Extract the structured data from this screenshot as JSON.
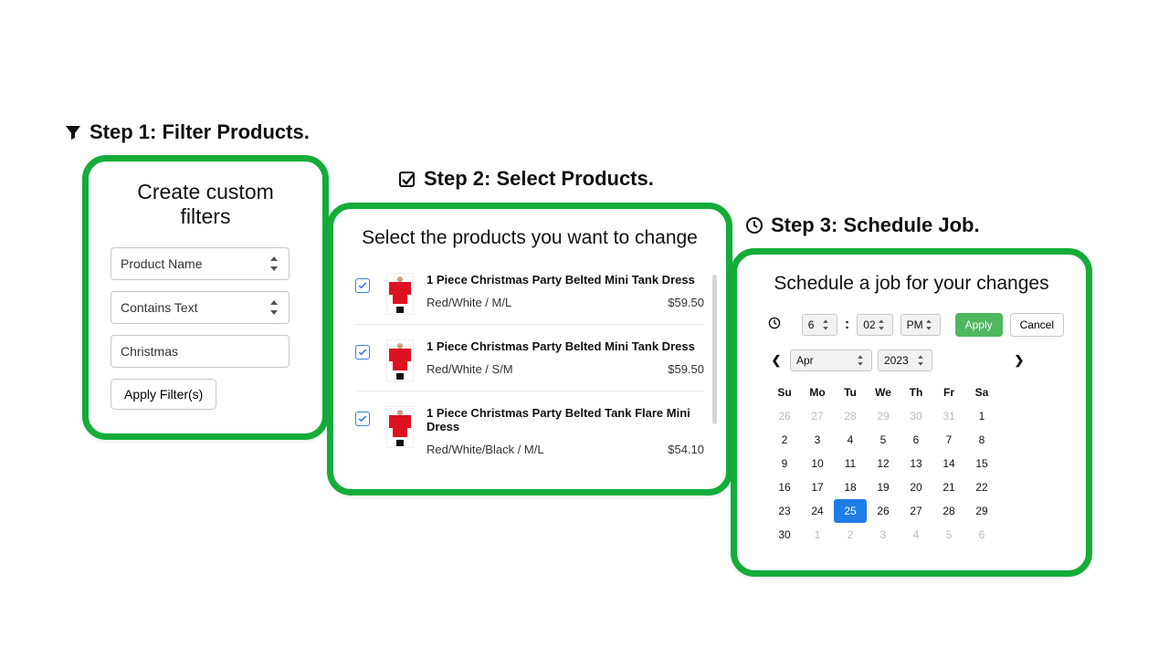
{
  "step1": {
    "heading": "Step 1: Filter Products.",
    "card_title": "Create custom filters",
    "field_select": "Product Name",
    "match_select": "Contains Text",
    "value_input": "Christmas",
    "apply": "Apply Filter(s)"
  },
  "step2": {
    "heading": "Step 2: Select Products.",
    "card_title": "Select the products you want to change",
    "products": [
      {
        "name": "1 Piece Christmas Party Belted Mini Tank Dress",
        "variant": "Red/White / M/L",
        "price": "$59.50"
      },
      {
        "name": "1 Piece Christmas Party Belted Mini Tank Dress",
        "variant": "Red/White / S/M",
        "price": "$59.50"
      },
      {
        "name": "1 Piece Christmas Party Belted Tank Flare Mini Dress",
        "variant": "Red/White/Black / M/L",
        "price": "$54.10"
      }
    ]
  },
  "step3": {
    "heading": "Step 3: Schedule Job.",
    "card_title": "Schedule a job for your changes",
    "time": {
      "hour": "6",
      "minute": "02",
      "ampm": "PM"
    },
    "apply": "Apply",
    "cancel": "Cancel",
    "month": "Apr",
    "year": "2023",
    "dow": [
      "Su",
      "Mo",
      "Tu",
      "We",
      "Th",
      "Fr",
      "Sa"
    ],
    "weeks": [
      [
        {
          "d": "26",
          "m": true
        },
        {
          "d": "27",
          "m": true
        },
        {
          "d": "28",
          "m": true
        },
        {
          "d": "29",
          "m": true
        },
        {
          "d": "30",
          "m": true
        },
        {
          "d": "31",
          "m": true
        },
        {
          "d": "1"
        }
      ],
      [
        {
          "d": "2"
        },
        {
          "d": "3"
        },
        {
          "d": "4"
        },
        {
          "d": "5"
        },
        {
          "d": "6"
        },
        {
          "d": "7"
        },
        {
          "d": "8"
        }
      ],
      [
        {
          "d": "9"
        },
        {
          "d": "10"
        },
        {
          "d": "11"
        },
        {
          "d": "12"
        },
        {
          "d": "13"
        },
        {
          "d": "14"
        },
        {
          "d": "15"
        }
      ],
      [
        {
          "d": "16"
        },
        {
          "d": "17"
        },
        {
          "d": "18"
        },
        {
          "d": "19"
        },
        {
          "d": "20"
        },
        {
          "d": "21"
        },
        {
          "d": "22"
        }
      ],
      [
        {
          "d": "23"
        },
        {
          "d": "24"
        },
        {
          "d": "25",
          "sel": true
        },
        {
          "d": "26"
        },
        {
          "d": "27"
        },
        {
          "d": "28"
        },
        {
          "d": "29"
        }
      ],
      [
        {
          "d": "30"
        },
        {
          "d": "1",
          "m": true
        },
        {
          "d": "2",
          "m": true
        },
        {
          "d": "3",
          "m": true
        },
        {
          "d": "4",
          "m": true
        },
        {
          "d": "5",
          "m": true
        },
        {
          "d": "6",
          "m": true
        }
      ]
    ]
  }
}
